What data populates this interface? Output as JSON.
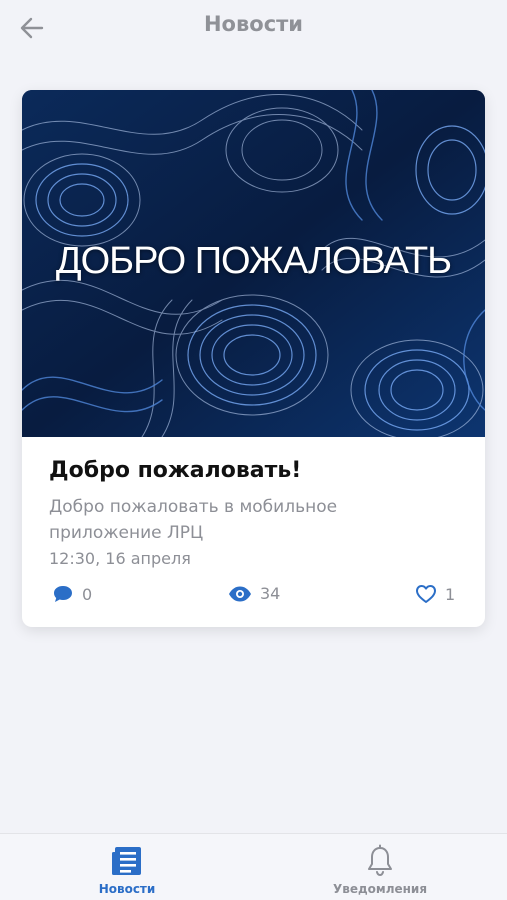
{
  "header": {
    "title": "Новости"
  },
  "card": {
    "banner_text": "ДОБРО ПОЖАЛОВАТЬ",
    "title": "Добро пожаловать!",
    "description": "Добро пожаловать в мобильное приложение ЛРЦ",
    "datetime": "12:30, 16 апреля",
    "comments_count": "0",
    "views_count": "34",
    "likes_count": "1"
  },
  "tabbar": {
    "tabs": [
      {
        "label": "Новости",
        "icon": "news-icon",
        "active": true
      },
      {
        "label": "Уведомления",
        "icon": "bell-icon",
        "active": false
      }
    ]
  },
  "colors": {
    "accent": "#2b6ec7",
    "muted": "#8d8f96",
    "background": "#f2f3f8"
  }
}
